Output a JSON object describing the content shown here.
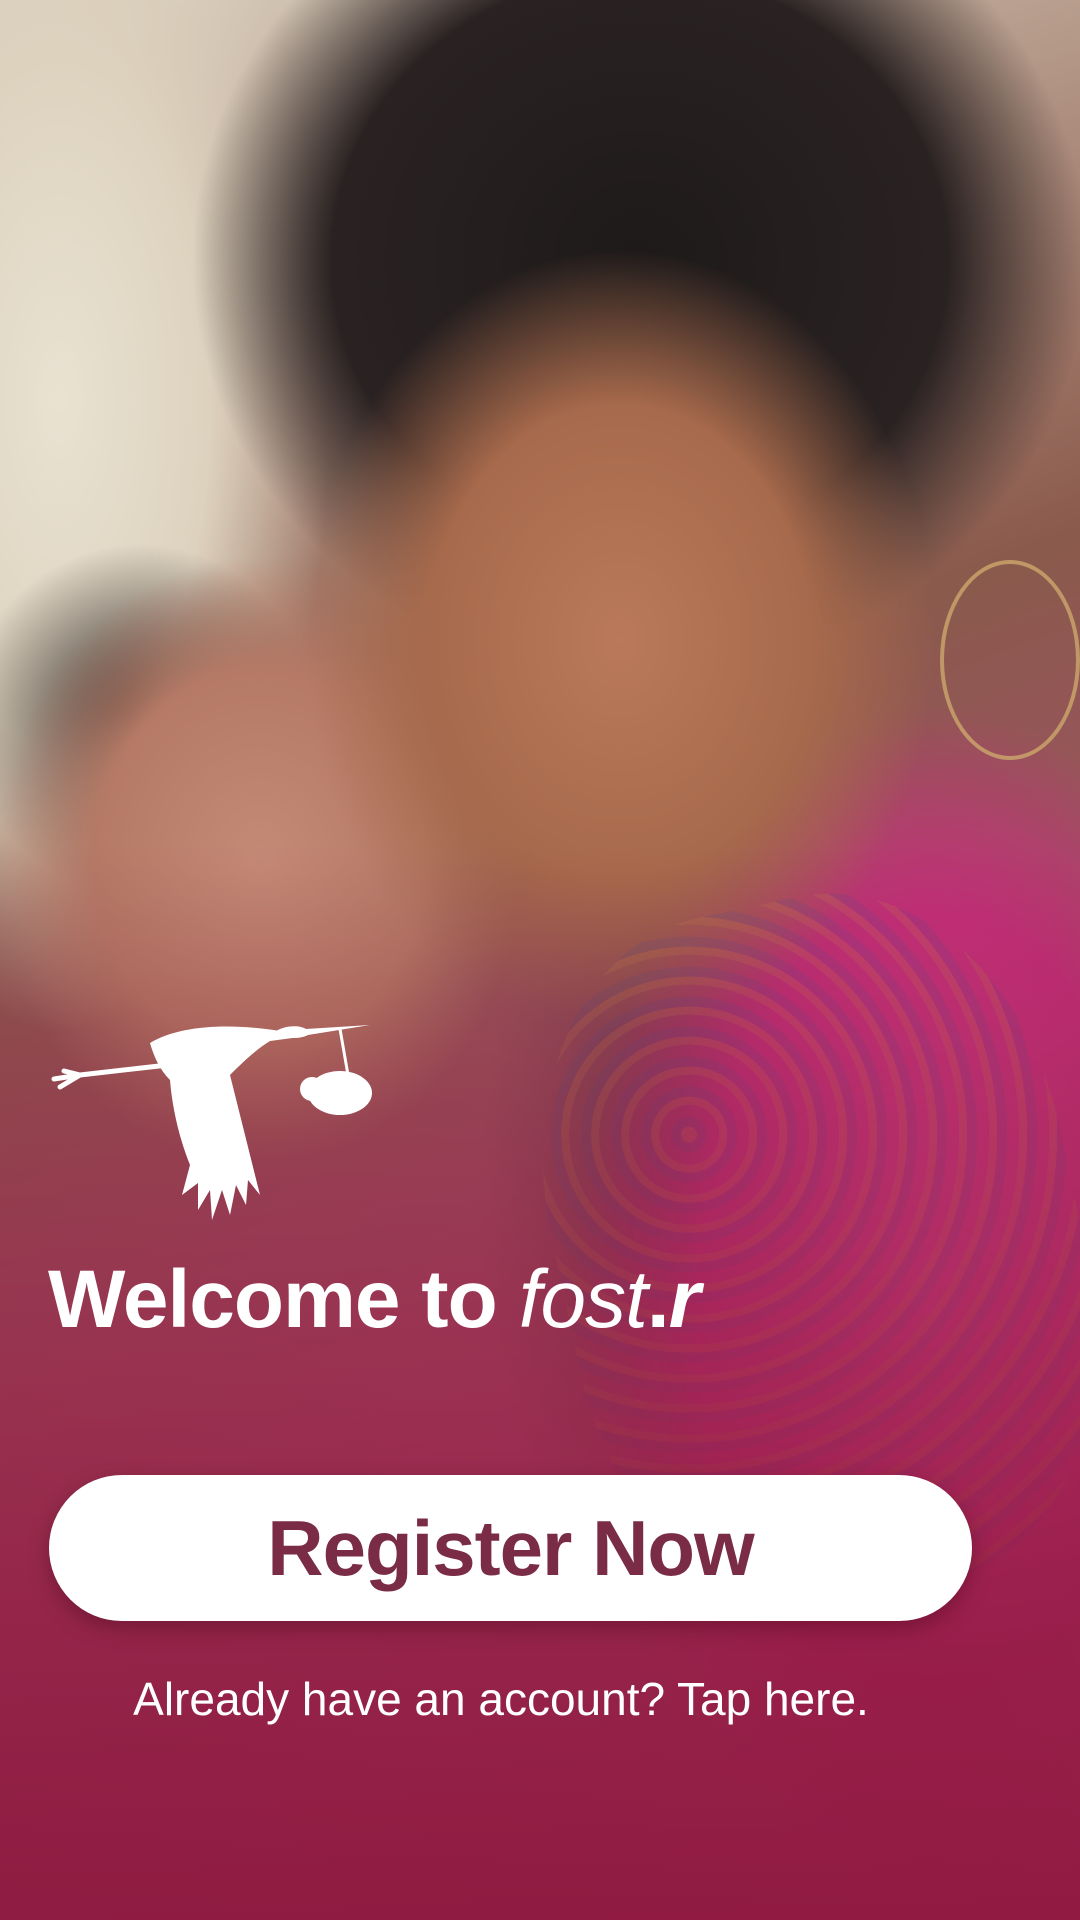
{
  "welcome": {
    "prefix": "Welcome to",
    "brand_italic": "fost",
    "brand_dot": ".",
    "brand_end": "r"
  },
  "actions": {
    "register_label": "Register Now",
    "login_link_label": "Already have an account? Tap here."
  },
  "logo": {
    "icon": "stork-carrying-baby-icon"
  },
  "colors": {
    "brand_maroon": "#7a2b45",
    "overlay": "#8c1e3c",
    "button_bg": "#ffffff",
    "text": "#ffffff"
  }
}
